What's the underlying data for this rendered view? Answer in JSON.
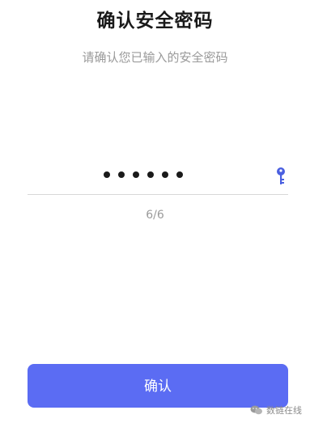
{
  "header": {
    "title": "确认安全密码",
    "subtitle": "请确认您已输入的安全密码"
  },
  "password": {
    "masked_count": 6,
    "counter_text": "6/6",
    "toggle_icon": "key-icon"
  },
  "actions": {
    "confirm_label": "确认"
  },
  "watermark": {
    "text": "数链在线",
    "icon": "wechat-icon"
  },
  "colors": {
    "accent": "#5b6cf3",
    "key_icon": "#4a5fe0"
  }
}
